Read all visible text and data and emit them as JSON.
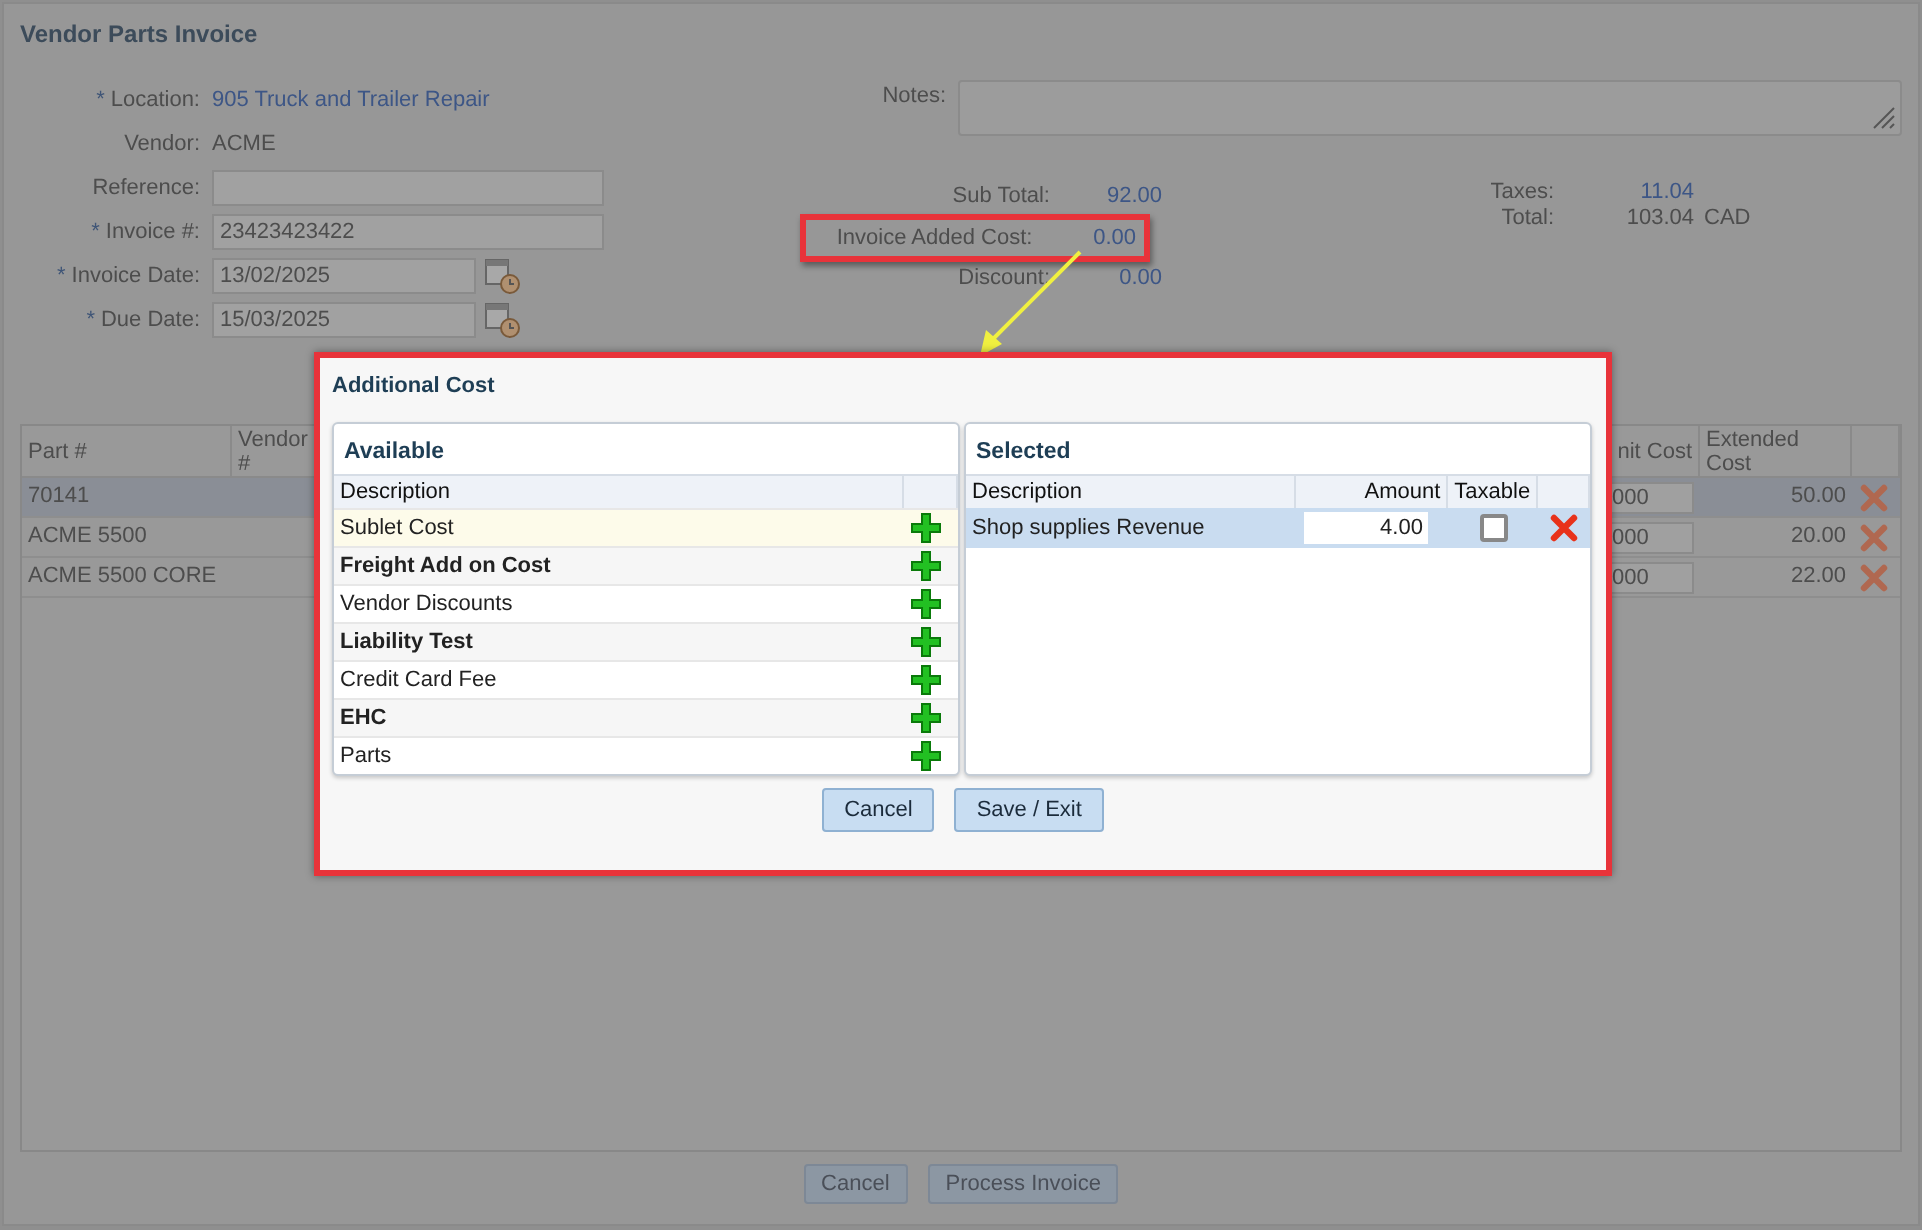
{
  "window": {
    "title": "Vendor Parts Invoice"
  },
  "form": {
    "fields": [
      {
        "required_mark": "*",
        "label": "Location:",
        "kind": "link",
        "value": "905 Truck and Trailer Repair"
      },
      {
        "label": "Vendor:",
        "kind": "text",
        "value": "ACME"
      },
      {
        "label": "Reference:",
        "kind": "input"
      },
      {
        "required_mark": "*",
        "label": "Invoice #:",
        "kind": "input",
        "value": "23423423422"
      },
      {
        "required_mark": "*",
        "label": "Invoice Date:",
        "kind": "date",
        "value": "13/02/2025"
      },
      {
        "required_mark": "*",
        "label": "Due Date:",
        "kind": "date",
        "value": "15/03/2025"
      }
    ],
    "notes": {
      "label": "Notes:"
    }
  },
  "totals": {
    "left": [
      {
        "label": "Sub Total:",
        "value": "92.00",
        "highlighted": false
      },
      {
        "label": "Invoice Added Cost:",
        "value": "0.00",
        "highlighted": true
      },
      {
        "label": "Discount:",
        "value": "0.00",
        "highlighted": false
      }
    ],
    "right": [
      {
        "label": "Taxes:",
        "value": "11.04"
      },
      {
        "label": "Total:",
        "value": "103.04",
        "currency": "CAD"
      }
    ]
  },
  "callout_arrow": true,
  "table": {
    "columns": [
      "Part #",
      "Vendor #",
      "nit Cost",
      "Extended Cost"
    ],
    "rows": [
      {
        "part": "70141",
        "unit_cost": "000",
        "extended_cost": "50.00",
        "selected": true
      },
      {
        "part": "ACME 5500",
        "unit_cost": "000",
        "extended_cost": "20.00",
        "selected": false
      },
      {
        "part": "ACME 5500 CORE",
        "unit_cost": "000",
        "extended_cost": "22.00",
        "selected": false
      }
    ]
  },
  "buttons": [
    "Cancel",
    "Process Invoice"
  ],
  "dialog": {
    "title": "Additional Cost",
    "highlighted": true,
    "available": {
      "title": "Available",
      "columns": [
        "Description"
      ],
      "items": [
        {
          "description": "Sublet Cost",
          "bold": false,
          "selected": true
        },
        {
          "description": "Freight Add on Cost",
          "bold": true,
          "selected": false
        },
        {
          "description": "Vendor Discounts",
          "bold": false,
          "selected": false
        },
        {
          "description": "Liability Test",
          "bold": true,
          "selected": false
        },
        {
          "description": "Credit Card Fee",
          "bold": false,
          "selected": false
        },
        {
          "description": "EHC",
          "bold": true,
          "selected": false
        },
        {
          "description": "Parts",
          "bold": false,
          "selected": false
        }
      ]
    },
    "selected": {
      "title": "Selected",
      "columns": [
        "Description",
        "Amount",
        "Taxable"
      ],
      "items": [
        {
          "description": "Shop supplies Revenue",
          "amount": "4.00",
          "taxable": false
        }
      ]
    },
    "buttons": [
      "Cancel",
      "Save / Exit"
    ]
  }
}
